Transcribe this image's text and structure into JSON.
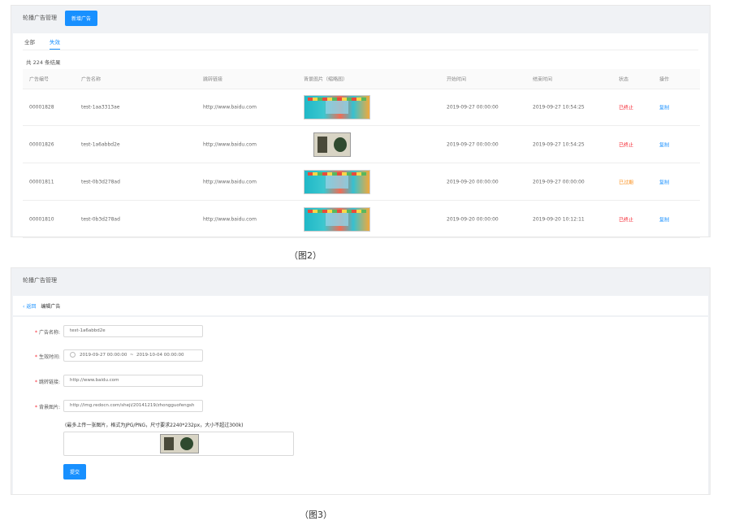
{
  "fig2": {
    "title": "轮播广告管理",
    "add_button": "新增广告",
    "tabs": [
      "全部",
      "失效"
    ],
    "result_count": "共 224 条结果",
    "columns": [
      "广告编号",
      "广告名称",
      "跳转链接",
      "背景图片（缩略图）",
      "开始时间",
      "结束时间",
      "状态",
      "操作"
    ],
    "rows": [
      {
        "id": "00001828",
        "name": "test-1aa3313ae",
        "link": "http://www.baidu.com",
        "image": "banner-wide",
        "start": "2019-09-27 00:00:00",
        "end": "2019-09-27 10:54:25",
        "status": "已终止",
        "status_color": "#f5222d",
        "action": "复制"
      },
      {
        "id": "00001826",
        "name": "test-1a6abbd2e",
        "link": "http://www.baidu.com",
        "image": "banner-small",
        "start": "2019-09-27 00:00:00",
        "end": "2019-09-27 10:54:25",
        "status": "已终止",
        "status_color": "#f5222d",
        "action": "复制"
      },
      {
        "id": "00001811",
        "name": "test-0b3d278ad",
        "link": "http://www.baidu.com",
        "image": "banner-wide",
        "start": "2019-09-20 00:00:00",
        "end": "2019-09-27 00:00:00",
        "status": "已过期",
        "status_color": "#fa8c16",
        "action": "复制"
      },
      {
        "id": "00001810",
        "name": "test-0b3d278ad",
        "link": "http://www.baidu.com",
        "image": "banner-wide",
        "start": "2019-09-20 00:00:00",
        "end": "2019-09-20 10:12:11",
        "status": "已终止",
        "status_color": "#f5222d",
        "action": "复制"
      }
    ],
    "caption": "（图2）"
  },
  "fig3": {
    "title": "轮播广告管理",
    "back_label": "返回",
    "page_title": "编辑广告",
    "fields": {
      "name_label": "广告名称:",
      "name_value": "test-1a6abbd2e",
      "time_label": "生效时间:",
      "time_start": "2019-09-27 00:00:00",
      "time_sep": "~",
      "time_end": "2019-10-04 00:00:00",
      "link_label": "跳转链接:",
      "link_value": "http://www.baidu.com",
      "image_label": "背景图片:",
      "image_value": "http://img.redocn.com/sheji/20141219/zhongguofengsh",
      "hint": "(最多上传一张图片，格式为JPG/PNG，尺寸要求2240*232px，大小不超过300k)"
    },
    "required_mark": "*",
    "submit_label": "提交",
    "caption": "（图3）"
  },
  "colors": {
    "accent": "#1890ff",
    "danger": "#f5222d",
    "warning": "#fa8c16"
  }
}
